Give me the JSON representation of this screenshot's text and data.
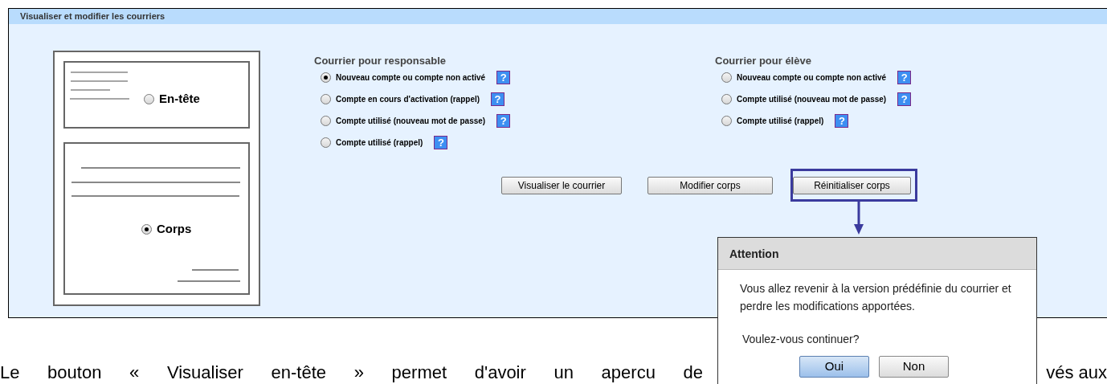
{
  "panel": {
    "title": "Visualiser et modifier les courriers"
  },
  "letter": {
    "parts": [
      {
        "kind": "header",
        "label": "En-tête",
        "selected": false
      },
      {
        "kind": "body",
        "label": "Corps",
        "selected": true
      }
    ]
  },
  "groups": [
    {
      "title": "Courrier pour responsable",
      "options": [
        {
          "label": "Nouveau compte ou compte non activé",
          "selected": true,
          "help": "?"
        },
        {
          "label": "Compte en cours d'activation (rappel)",
          "selected": false,
          "help": "?"
        },
        {
          "label": "Compte utilisé (nouveau mot de passe)",
          "selected": false,
          "help": "?"
        },
        {
          "label": "Compte utilisé (rappel)",
          "selected": false,
          "help": "?"
        }
      ]
    },
    {
      "title": "Courrier pour élève",
      "options": [
        {
          "label": "Nouveau compte ou compte non activé",
          "selected": false,
          "help": "?"
        },
        {
          "label": "Compte utilisé (nouveau mot de passe)",
          "selected": false,
          "help": "?"
        },
        {
          "label": "Compte utilisé (rappel)",
          "selected": false,
          "help": "?"
        }
      ]
    }
  ],
  "buttons": [
    {
      "label": "Visualiser le courrier",
      "highlighted": false
    },
    {
      "label": "Modifier corps",
      "highlighted": false
    },
    {
      "label": "Réinitialiser corps",
      "highlighted": true
    }
  ],
  "dialog": {
    "title": "Attention",
    "message": "Vous allez revenir à la version prédéfinie du courrier et perdre les modifications apportées.",
    "question": "Voulez-vous continuer?",
    "buttons": [
      {
        "label": "Oui",
        "default": true
      },
      {
        "label": "Non",
        "default": false
      }
    ]
  },
  "body_text": {
    "before": "Le bouton « Visualiser en-tête » permet d'avoir un apercu de",
    "after": "vés aux"
  }
}
